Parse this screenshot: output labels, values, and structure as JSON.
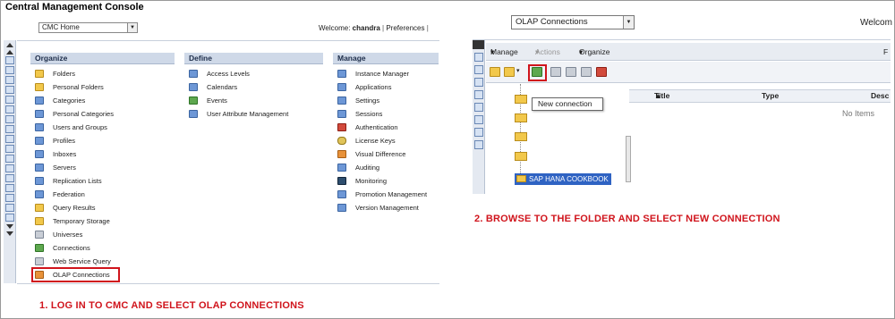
{
  "left": {
    "app_title": "Central Management Console",
    "home_select": "CMC Home",
    "welcome_label": "Welcome:",
    "username": "chandra",
    "preferences": "Preferences",
    "organize": {
      "header": "Organize",
      "items": [
        "Folders",
        "Personal Folders",
        "Categories",
        "Personal Categories",
        "Users and Groups",
        "Profiles",
        "Inboxes",
        "Servers",
        "Replication Lists",
        "Federation",
        "Query Results",
        "Temporary Storage",
        "Universes",
        "Connections",
        "Web Service Query",
        "OLAP Connections"
      ]
    },
    "define": {
      "header": "Define",
      "items": [
        "Access Levels",
        "Calendars",
        "Events",
        "User Attribute Management"
      ]
    },
    "manage": {
      "header": "Manage",
      "items": [
        "Instance Manager",
        "Applications",
        "Settings",
        "Sessions",
        "Authentication",
        "License Keys",
        "Visual Difference",
        "Auditing",
        "Monitoring",
        "Promotion Management",
        "Version Management"
      ]
    },
    "caption": "1. LOG IN TO CMC AND SELECT OLAP CONNECTIONS"
  },
  "right": {
    "select_value": "OLAP Connections",
    "welcome_partial": "Welcom",
    "menu": {
      "manage": "Manage",
      "actions": "Actions",
      "organize": "Organize",
      "extra": "F"
    },
    "tooltip": "New connection",
    "tree_selected": "SAP HANA COOKBOOK",
    "columns": [
      "Title",
      "Type",
      "Desc"
    ],
    "empty_text": "No Items",
    "caption": "2. BROWSE TO THE FOLDER AND SELECT NEW CONNECTION"
  },
  "colors": {
    "highlight_red": "#d0141c",
    "section_header": "#cfd9e8",
    "selection_blue": "#2f63c3"
  }
}
